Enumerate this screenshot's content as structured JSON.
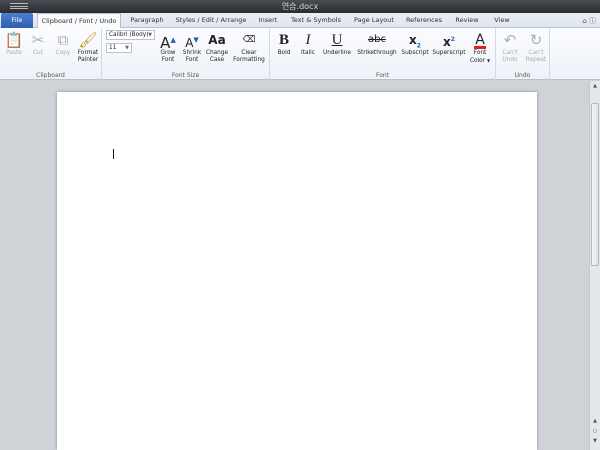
{
  "window": {
    "title": "연습.docx"
  },
  "tabs": [
    {
      "label": "File"
    },
    {
      "label": "Clipboard / Font / Undo"
    },
    {
      "label": "Paragraph"
    },
    {
      "label": "Styles / Edit / Arrange"
    },
    {
      "label": "Insert"
    },
    {
      "label": "Text & Symbols"
    },
    {
      "label": "Page Layout"
    },
    {
      "label": "References"
    },
    {
      "label": "Review"
    },
    {
      "label": "View"
    }
  ],
  "ribbon": {
    "clipboard": {
      "group_label": "Clipboard",
      "paste": "Paste",
      "cut": "Cut",
      "copy": "Copy",
      "format_painter_1": "Format",
      "format_painter_2": "Painter"
    },
    "font_size": {
      "group_label": "Font Size",
      "font_name": "Calibri (Body)",
      "font_size": "11",
      "grow_1": "Grow",
      "grow_2": "Font",
      "shrink_1": "Shrink",
      "shrink_2": "Font",
      "change_case_1": "Change",
      "change_case_2": "Case",
      "clear_1": "Clear",
      "clear_2": "Formatting"
    },
    "font": {
      "group_label": "Font",
      "bold": "Bold",
      "italic": "Italic",
      "underline": "Underline",
      "strikethrough": "Strikethrough",
      "subscript": "Subscript",
      "superscript": "Superscript",
      "font_color_1": "Font",
      "font_color_2": "Color"
    },
    "undo": {
      "group_label": "Undo",
      "undo_1": "Can't",
      "undo_2": "Undo",
      "repeat_1": "Can't",
      "repeat_2": "Repeat"
    }
  },
  "colors": {
    "font_color_bar": "#e02020",
    "file_tab": "#3a6cc0"
  }
}
